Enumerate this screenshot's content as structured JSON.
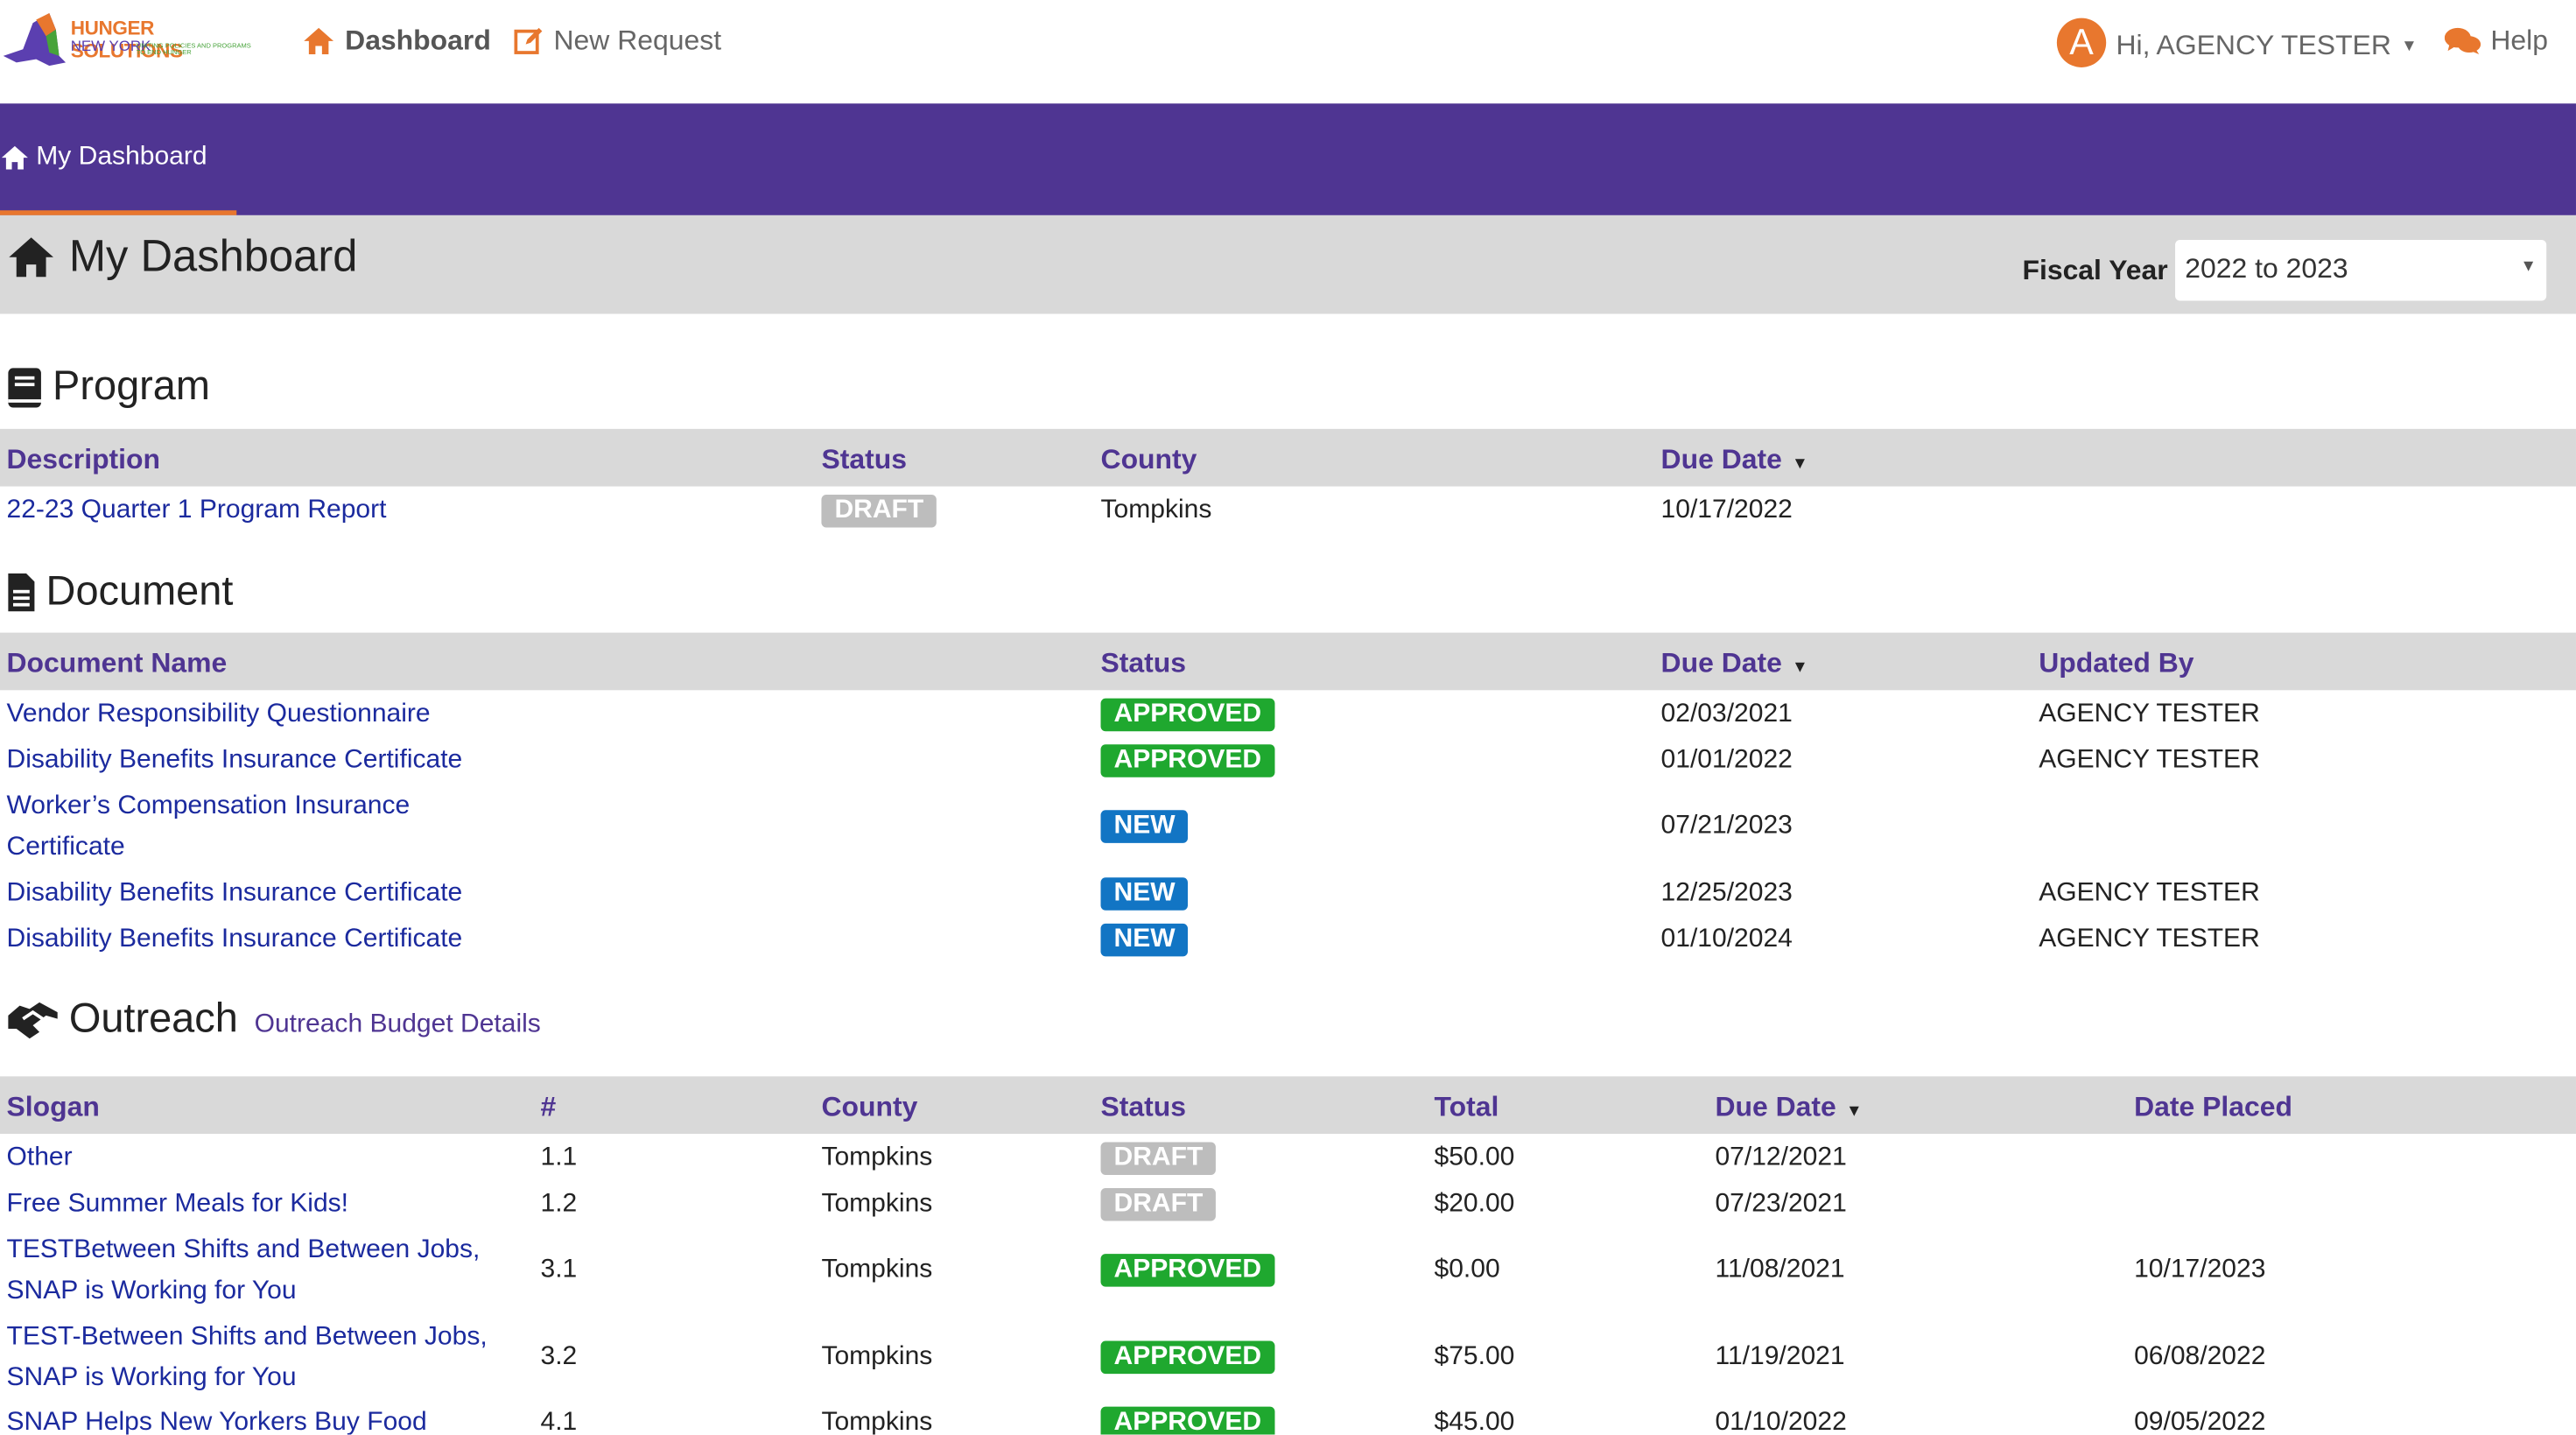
{
  "nav": {
    "logo_line1": "HUNGER SOLUTIONS",
    "logo_line2": "NEW YORK",
    "logo_tagline": "UNITING POLICIES AND PROGRAMS TO END HUNGER",
    "dashboard": "Dashboard",
    "new_request": "New Request",
    "avatar_letter": "A",
    "greeting": "Hi, AGENCY TESTER",
    "help": "Help"
  },
  "subnav": {
    "tab": "My Dashboard"
  },
  "header": {
    "title": "My Dashboard",
    "fiscal_year_label": "Fiscal Year",
    "fiscal_year_value": "2022 to 2023"
  },
  "program": {
    "title": "Program",
    "columns": [
      "Description",
      "Status",
      "County",
      "Due Date"
    ],
    "rows": [
      {
        "description": "22-23 Quarter 1 Program Report",
        "status": "DRAFT",
        "county": "Tompkins",
        "due": "10/17/2022"
      }
    ]
  },
  "document": {
    "title": "Document",
    "columns": [
      "Document Name",
      "Status",
      "Due Date",
      "Updated By"
    ],
    "rows": [
      {
        "name": "Vendor Responsibility Questionnaire",
        "status": "APPROVED",
        "due": "02/03/2021",
        "updated_by": "AGENCY TESTER"
      },
      {
        "name": "Disability Benefits Insurance Certificate",
        "status": "APPROVED",
        "due": "01/01/2022",
        "updated_by": "AGENCY TESTER"
      },
      {
        "name": "Worker’s Compensation Insurance Certificate",
        "name_line1": "Worker’s Compensation Insurance",
        "name_line2": "Certificate",
        "status": "NEW",
        "due": "07/21/2023",
        "updated_by": ""
      },
      {
        "name": "Disability Benefits Insurance Certificate",
        "status": "NEW",
        "due": "12/25/2023",
        "updated_by": "AGENCY TESTER"
      },
      {
        "name": "Disability Benefits Insurance Certificate",
        "status": "NEW",
        "due": "01/10/2024",
        "updated_by": "AGENCY TESTER"
      }
    ]
  },
  "outreach": {
    "title": "Outreach",
    "details_link": "Outreach Budget Details",
    "columns": [
      "Slogan",
      "#",
      "County",
      "Status",
      "Total",
      "Due Date",
      "Date Placed"
    ],
    "rows": [
      {
        "slogan": "Other",
        "num": "1.1",
        "county": "Tompkins",
        "status": "DRAFT",
        "total": "$50.00",
        "due": "07/12/2021",
        "placed": ""
      },
      {
        "slogan": "Free Summer Meals for Kids!",
        "num": "1.2",
        "county": "Tompkins",
        "status": "DRAFT",
        "total": "$20.00",
        "due": "07/23/2021",
        "placed": ""
      },
      {
        "slogan": "TESTBetween Shifts and Between Jobs, SNAP is Working for You",
        "slogan_line1": "TESTBetween Shifts and Between Jobs,",
        "slogan_line2": "SNAP is Working for You",
        "num": "3.1",
        "county": "Tompkins",
        "status": "APPROVED",
        "total": "$0.00",
        "due": "11/08/2021",
        "placed": "10/17/2023"
      },
      {
        "slogan": "TEST-Between Shifts and Between Jobs, SNAP is Working for You",
        "slogan_line1": "TEST-Between Shifts and Between Jobs,",
        "slogan_line2": "SNAP is Working for You",
        "num": "3.2",
        "county": "Tompkins",
        "status": "APPROVED",
        "total": "$75.00",
        "due": "11/19/2021",
        "placed": "06/08/2022"
      },
      {
        "slogan": "SNAP Helps New Yorkers Buy Food",
        "num": "4.1",
        "county": "Tompkins",
        "status": "APPROVED",
        "total": "$45.00",
        "due": "01/10/2022",
        "placed": "09/05/2022"
      }
    ]
  },
  "colors": {
    "purple": "#4f3592",
    "orange": "#e8772e",
    "approved": "#1fa82f",
    "new": "#1275c4",
    "draft": "#bdbdbd",
    "link": "#1b2a9e"
  }
}
